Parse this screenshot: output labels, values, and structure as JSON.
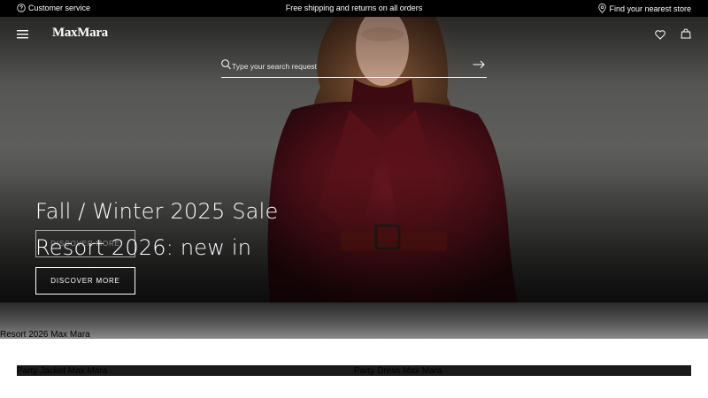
{
  "topbar": {
    "customer_service": "Customer service",
    "shipping": "Free shipping and returns on all orders",
    "store_locator": "Find your nearest store"
  },
  "header": {
    "logo": "MaxMara",
    "icons": [
      "menu-icon",
      "heart-icon",
      "bag-icon"
    ]
  },
  "search": {
    "placeholder": "Type your search request"
  },
  "hero": {
    "headline_1": "Fall / Winter 2025 Sale",
    "cta_1": "DISCOVER MORE",
    "headline_2": "Resort 2026: new in",
    "cta_2": "DISCOVER MORE"
  },
  "sections": {
    "resort_label": "Resort 2026 Max Mara",
    "tile_1": "Party Jacket Max Mara",
    "tile_2": "Party Dress Max Mara"
  }
}
